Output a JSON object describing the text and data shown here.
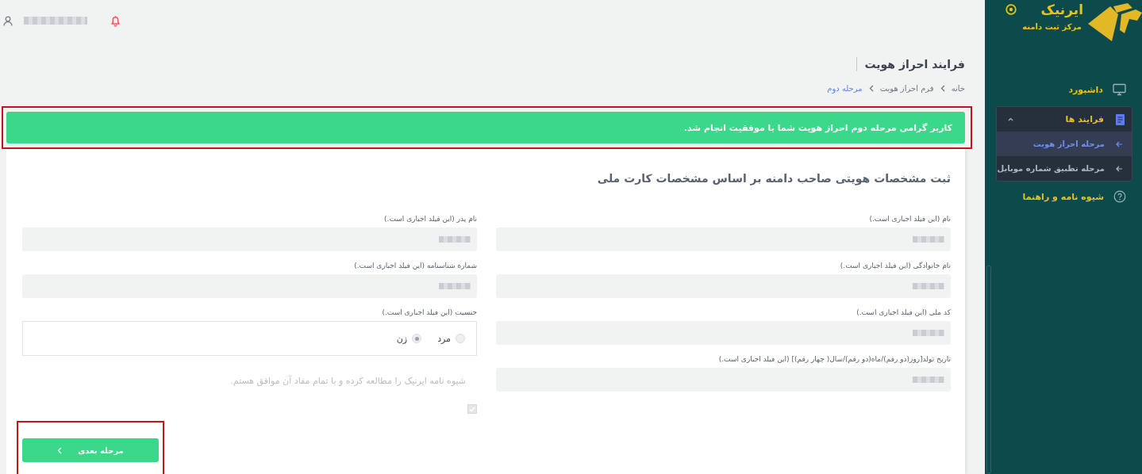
{
  "sidebar": {
    "brand": "ایرنیک",
    "subtitle": "مرکز ثبت دامنه",
    "items": [
      {
        "label": "داشبورد",
        "kind": "link"
      },
      {
        "label": "فرایند ها",
        "kind": "group",
        "expanded": true,
        "children": [
          {
            "label": "مرحله احراز هویت",
            "selected": true
          },
          {
            "label": "مرحله تطبیق شماره موبایل",
            "selected": false
          }
        ]
      },
      {
        "label": "شیوه نامه و راهنما",
        "kind": "help"
      }
    ]
  },
  "page": {
    "title": "فرایند احراز هویت",
    "breadcrumb": [
      {
        "label": "خانه",
        "current": false
      },
      {
        "label": "فرم احراز هویت",
        "current": false
      },
      {
        "label": "مرحله دوم",
        "current": true
      }
    ]
  },
  "alert": {
    "message": "کاربر گرامی مرحله دوم احراز هویت شما با موفقیت انجام شد."
  },
  "form": {
    "heading": "ثبت مشخصات هویتی صاحب دامنه بر اساس مشخصات کارت ملی",
    "columns": [
      [
        {
          "kind": "text",
          "label": "نام (این فیلد اجباری است.)"
        },
        {
          "kind": "text",
          "label": "نام خانوادگی (این فیلد اجباری است.)"
        },
        {
          "kind": "text",
          "label": "کد ملی (این فیلد اجباری است.)"
        },
        {
          "kind": "text",
          "label": "تاریخ تولد[روز(دو رقم)/ماه(دو رقم)/سال( چهار رقم)] (این فیلد اجباری است.)"
        }
      ],
      [
        {
          "kind": "text",
          "label": "نام پدر (این فیلد اجباری است.)"
        },
        {
          "kind": "text",
          "label": "شماره شناسنامه (این فیلد اجباری است.)"
        },
        {
          "kind": "radio",
          "label": "جنسیت (این فیلد اجباری است.)",
          "options": [
            {
              "label": "مرد",
              "selected": false
            },
            {
              "label": "زن",
              "selected": true
            }
          ]
        },
        {
          "kind": "agreement",
          "label": "شیوه نامه ایرنیک را مطالعه کرده و با تمام مفاد آن موافق هستم.",
          "checked": true
        }
      ]
    ]
  },
  "next_button": {
    "label": "مرحله بعدی"
  }
}
